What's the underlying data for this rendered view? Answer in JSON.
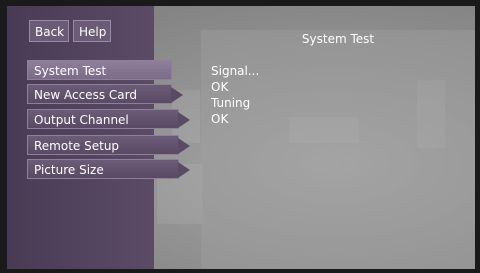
{
  "top_buttons": {
    "back": "Back",
    "help": "Help"
  },
  "menu": {
    "items": [
      {
        "label": "System Test"
      },
      {
        "label": "New Access Card"
      },
      {
        "label": "Output Channel"
      },
      {
        "label": "Remote Setup"
      },
      {
        "label": "Picture Size"
      }
    ]
  },
  "panel": {
    "title": "System Test",
    "lines": [
      "Signal...",
      "OK",
      "Tuning",
      "OK"
    ]
  }
}
